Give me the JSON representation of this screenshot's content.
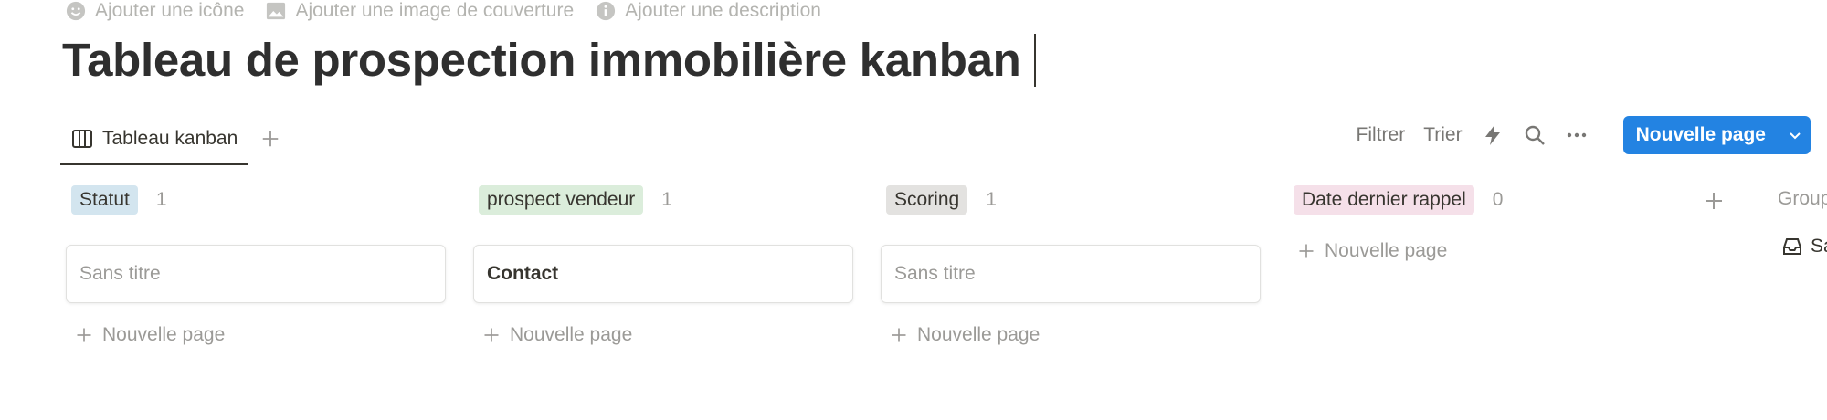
{
  "page_meta": {
    "add_icon": "Ajouter une icône",
    "add_cover": "Ajouter une image de couverture",
    "add_description": "Ajouter une description"
  },
  "title": "Tableau de prospection immobilière kanban",
  "view_tab": {
    "label": "Tableau kanban"
  },
  "toolbar": {
    "filter": "Filtrer",
    "sort": "Trier",
    "new_page": "Nouvelle page"
  },
  "columns": [
    {
      "tag": "Statut",
      "count": "1",
      "tag_color": "#d3e5ef",
      "card": "Sans titre",
      "card_is_placeholder": true,
      "add_label": "Nouvelle page"
    },
    {
      "tag": "prospect vendeur",
      "count": "1",
      "tag_color": "#dbeddb",
      "card": "Contact",
      "card_is_placeholder": false,
      "add_label": "Nouvelle page"
    },
    {
      "tag": "Scoring",
      "count": "1",
      "tag_color": "#e3e2e0",
      "card": "Sans titre",
      "card_is_placeholder": true,
      "add_label": "Nouvelle page"
    },
    {
      "tag": "Date dernier rappel",
      "count": "0",
      "tag_color": "#f5e0e9",
      "add_label": "Nouvelle page"
    }
  ],
  "hidden_groups": {
    "label": "Group",
    "item": "Sa"
  },
  "colors": {
    "accent": "#2383e2",
    "text": "#37352f",
    "muted": "#9b9a97"
  },
  "icons": [
    "smile-icon",
    "image-icon",
    "info-icon",
    "board-icon",
    "plus-icon",
    "lightning-icon",
    "search-icon",
    "more-icon",
    "chevron-down-icon",
    "inbox-icon"
  ]
}
